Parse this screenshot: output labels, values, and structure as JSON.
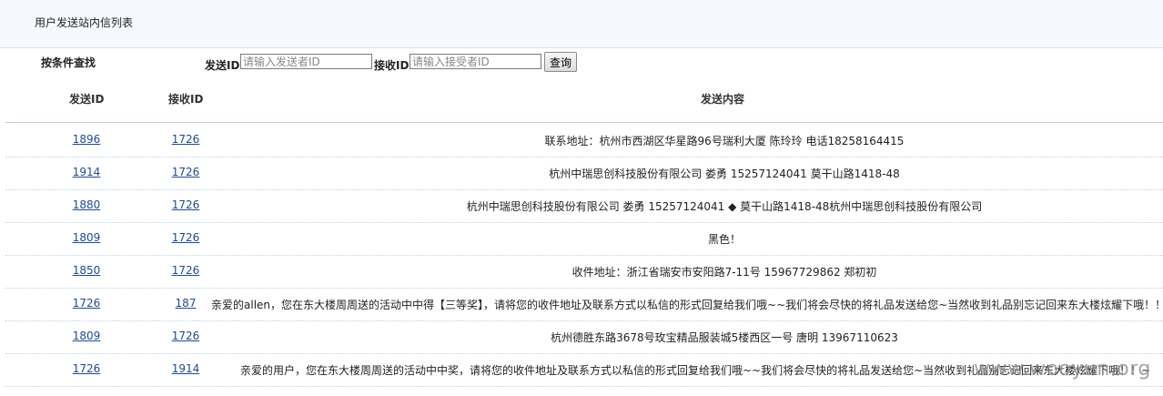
{
  "page": {
    "title": "用户发送站内信列表"
  },
  "search": {
    "heading": "按条件查找",
    "sender_label": "发送ID",
    "sender_placeholder": "请输入发送者ID",
    "receiver_label": "接收ID",
    "receiver_placeholder": "请输入接受者ID",
    "query_button": "查询"
  },
  "table": {
    "columns": [
      "发送ID",
      "接收ID",
      "发送内容"
    ],
    "rows": [
      {
        "sender": "1896",
        "receiver": "1726",
        "content": "联系地址：杭州市西湖区华星路96号瑞利大厦 陈玲玲 电话18258164415"
      },
      {
        "sender": "1914",
        "receiver": "1726",
        "content": "杭州中瑞思创科技股份有限公司 娄勇 15257124041 莫干山路1418-48"
      },
      {
        "sender": "1880",
        "receiver": "1726",
        "content": "杭州中瑞思创科技股份有限公司 娄勇 15257124041 ◆ 莫干山路1418-48杭州中瑞思创科技股份有限公司"
      },
      {
        "sender": "1809",
        "receiver": "1726",
        "content": "黑色！"
      },
      {
        "sender": "1850",
        "receiver": "1726",
        "content": "收件地址：浙江省瑞安市安阳路7-11号 15967729862 郑初初"
      },
      {
        "sender": "1726",
        "receiver": "187",
        "content": "亲爱的allen，您在东大楼周周送的活动中中得【三等奖】，请将您的收件地址及联系方式以私信的形式回复给我们哦~~我们将会尽快的将礼品发送给您~当然收到礼品别忘记回来东大楼炫耀下哦！！~"
      },
      {
        "sender": "1809",
        "receiver": "1726",
        "content": "杭州德胜东路3678号玫宝精品服装城5楼西区一号 唐明 13967110623"
      },
      {
        "sender": "1726",
        "receiver": "1914",
        "content": "亲爱的用户，您在东大楼周周送的活动中中奖，请将您的收件地址及联系方式以私信的形式回复给我们哦~~我们将会尽快的将礼品发送给您~当然收到礼品别忘记回来东大楼炫耀下哦！！~"
      }
    ]
  },
  "watermark": "www.wooyun.org"
}
